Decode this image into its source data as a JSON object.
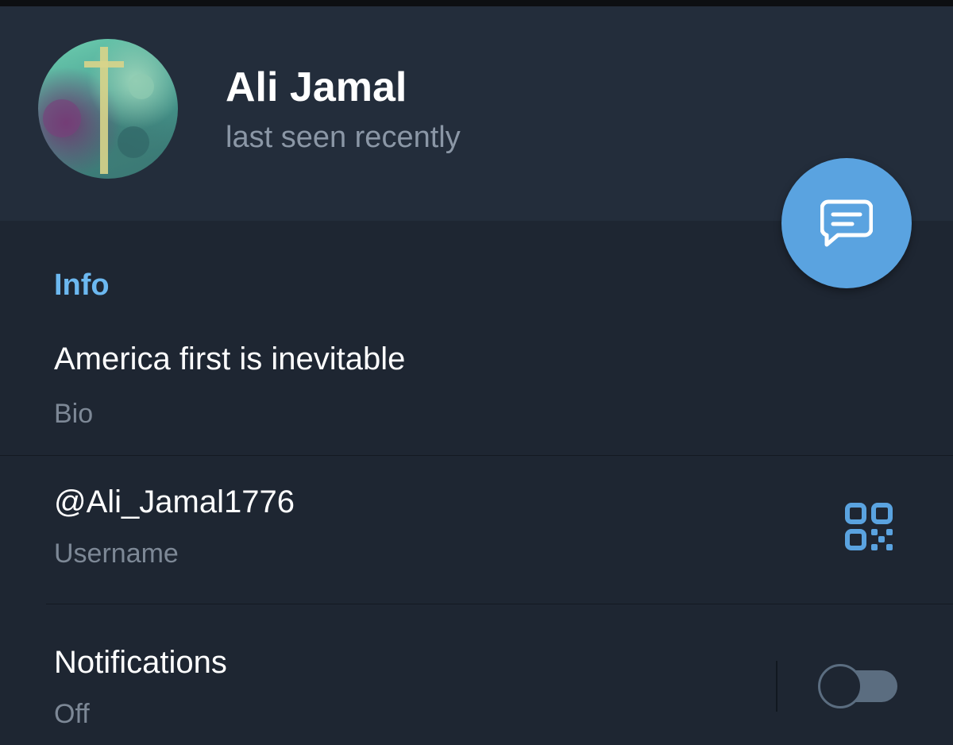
{
  "profile": {
    "name": "Ali Jamal",
    "status": "last seen recently"
  },
  "info": {
    "section_title": "Info",
    "bio": {
      "value": "America first is inevitable",
      "label": "Bio"
    },
    "username": {
      "value": "@Ali_Jamal1776",
      "label": "Username"
    },
    "notifications": {
      "title": "Notifications",
      "value": "Off",
      "enabled": false
    }
  },
  "colors": {
    "accent": "#5aa3e0",
    "section_title": "#6cb8f0",
    "background": "#1e2632",
    "header_background": "#232d3b"
  },
  "icons": {
    "fab": "message-icon",
    "username_action": "qr-code-icon"
  }
}
